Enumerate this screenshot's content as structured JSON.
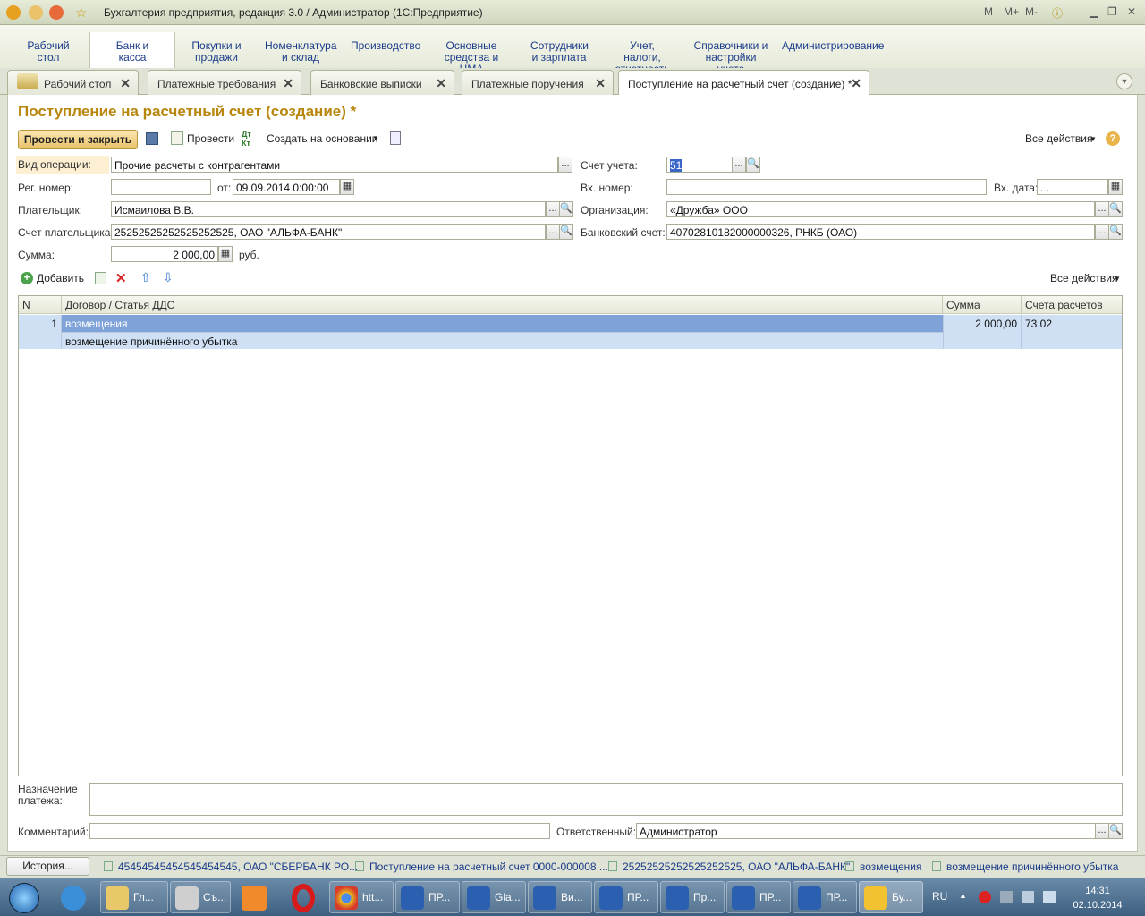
{
  "window": {
    "title": "Бухгалтерия предприятия, редакция 3.0 / Администратор  (1С:Предприятие)"
  },
  "sections": [
    {
      "label": "Рабочий стол"
    },
    {
      "label": "Банк и касса"
    },
    {
      "label": "Покупки и продажи"
    },
    {
      "label": "Номенклатура и склад"
    },
    {
      "label": "Производство"
    },
    {
      "label": "Основные средства и НМА"
    },
    {
      "label": "Сотрудники и зарплата"
    },
    {
      "label": "Учет, налоги, отчетность"
    },
    {
      "label": "Справочники и настройки учета"
    },
    {
      "label": "Администрирование"
    }
  ],
  "tabs": [
    {
      "label": "Рабочий стол"
    },
    {
      "label": "Платежные требования"
    },
    {
      "label": "Банковские выписки"
    },
    {
      "label": "Платежные поручения"
    },
    {
      "label": "Поступление на расчетный счет (создание) *"
    }
  ],
  "form": {
    "title": "Поступление на расчетный счет (создание) *",
    "toolbar": {
      "post_close": "Провести и закрыть",
      "post": "Провести",
      "create_based": "Создать на основании",
      "all_actions": "Все действия"
    },
    "op_type_label": "Вид операции:",
    "op_type": "Прочие расчеты с контрагентами",
    "account_label": "Счет учета:",
    "account": "51",
    "reg_no_label": "Рег. номер:",
    "reg_no": "",
    "from_label": "от:",
    "date": "09.09.2014  0:00:00",
    "in_no_label": "Вх. номер:",
    "in_no": "",
    "in_date_label": "Вх. дата:",
    "in_date": " .  .",
    "payer_label": "Плательщик:",
    "payer": "Исмаилова В.В.",
    "org_label": "Организация:",
    "org": "«Дружба» ООО",
    "payer_acc_label": "Счет плательщика:",
    "payer_acc": "25252525252525252525, ОАО \"АЛЬФА-БАНК\"",
    "bank_acc_label": "Банковский счет:",
    "bank_acc": "40702810182000000326, РНКБ (ОАО)",
    "sum_label": "Сумма:",
    "sum": "2 000,00",
    "currency": "руб.",
    "table_toolbar": {
      "add": "Добавить",
      "all_actions": "Все действия"
    },
    "table": {
      "headers": [
        "N",
        "Договор / Статья ДДС",
        "Сумма",
        "Счета расчетов"
      ],
      "rows": [
        {
          "n": "1",
          "contract": "возмещения",
          "dds": "возмещение причинённого убытка",
          "sum": "2 000,00",
          "account": "73.02"
        }
      ]
    },
    "purpose_label": "Назначение платежа:",
    "purpose": "",
    "comment_label": "Комментарий:",
    "comment": "",
    "responsible_label": "Ответственный:",
    "responsible": "Администратор"
  },
  "statusbar": {
    "history": "История...",
    "links": [
      "45454545454545454545, ОАО \"СБЕРБАНК РО...",
      "Поступление на расчетный счет 0000-000008 ...",
      "25252525252525252525, ОАО \"АЛЬФА-БАНК\"",
      "возмещения",
      "возмещение причинённого убытка"
    ]
  },
  "taskbar": {
    "items": [
      "Гл...",
      "Съ...",
      "htt...",
      "ПР...",
      "Gla...",
      "Ви...",
      "ПР...",
      "Пр...",
      "ПР...",
      "ПР...",
      "Бу..."
    ],
    "lang": "RU",
    "time": "14:31",
    "date": "02.10.2014"
  }
}
